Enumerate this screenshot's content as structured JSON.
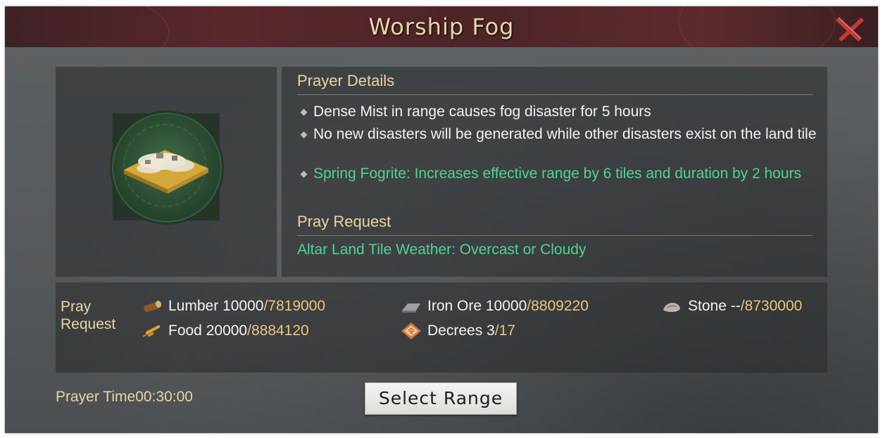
{
  "dialog": {
    "title": "Worship Fog",
    "close_icon": "close-x-icon",
    "accent_color": "#c63a36"
  },
  "image": {
    "icon": "fog-terrain-tile-icon"
  },
  "details": {
    "prayer_details_title": "Prayer Details",
    "bullets": [
      {
        "text": "Dense Mist in range causes fog disaster for 5 hours",
        "color": "#f2f2f2"
      },
      {
        "text": "No new disasters will be generated while other disasters exist on the land tile",
        "color": "#f2f2f2"
      },
      {
        "text": "Spring Fogrite: Increases effective range by 6 tiles and duration by 2 hours",
        "color": "#4fd394"
      }
    ],
    "pray_request_title": "Pray Request",
    "pray_request_text": "Altar Land Tile Weather: Overcast or Cloudy"
  },
  "resources": {
    "label": "Pray Request",
    "items": [
      {
        "icon": "lumber-log-icon",
        "name": "Lumber",
        "cost": "10000",
        "have": "/7819000"
      },
      {
        "icon": "iron-ore-icon",
        "name": "Iron Ore",
        "cost": "10000",
        "have": "/8809220"
      },
      {
        "icon": "stone-icon",
        "name": "Stone",
        "cost": "--",
        "have": "/8730000"
      },
      {
        "icon": "food-wheat-icon",
        "name": "Food",
        "cost": "20000",
        "have": "/8884120"
      },
      {
        "icon": "decree-token-icon",
        "name": "Decrees",
        "cost": "3",
        "have": "/17"
      }
    ]
  },
  "footer": {
    "prayer_time_label": "Prayer Time",
    "prayer_time_value": "00:30:00",
    "select_button": "Select Range"
  }
}
